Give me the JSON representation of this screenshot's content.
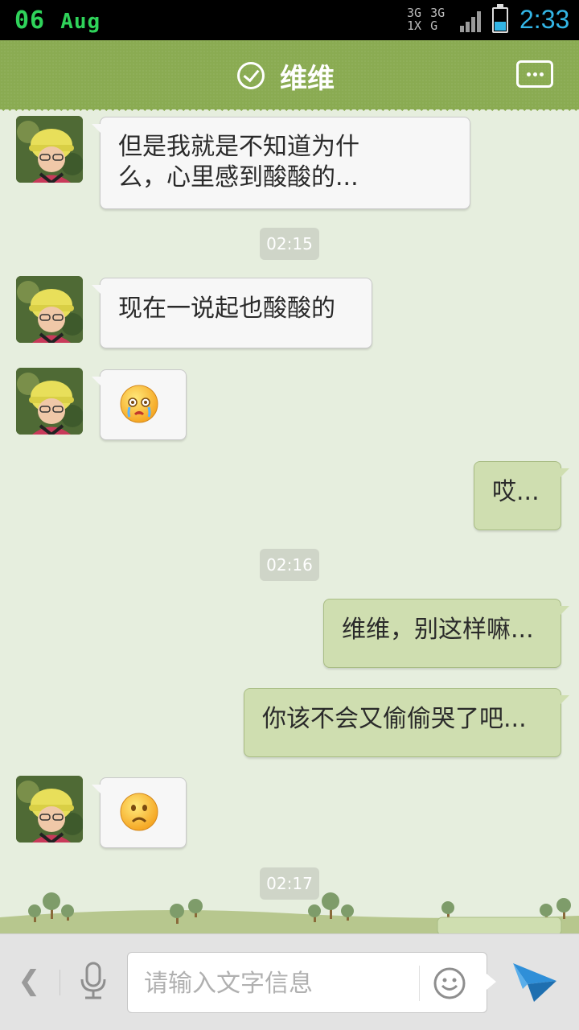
{
  "status_bar": {
    "date_day": "06",
    "date_month": "Aug",
    "network_top": "3G 3G 1X G",
    "time": "2:33"
  },
  "header": {
    "contact_name": "维维",
    "verified_icon": "check-circle-icon",
    "menu_icon": "chat-more-icon"
  },
  "messages": [
    {
      "type": "in",
      "text_line1": "但是我就是不知道为什",
      "text_line2": "么，心里感到酸酸的..."
    },
    {
      "type": "time",
      "text": "02:15"
    },
    {
      "type": "in",
      "text": "现在一说起也酸酸的"
    },
    {
      "type": "in",
      "emoji": "crying-face-emoji"
    },
    {
      "type": "out",
      "text": "哎..."
    },
    {
      "type": "time",
      "text": "02:16"
    },
    {
      "type": "out",
      "text": "维维，别这样嘛..."
    },
    {
      "type": "out",
      "text": "你该不会又偷偷哭了吧..."
    },
    {
      "type": "in",
      "emoji": "sad-face-emoji"
    },
    {
      "type": "time",
      "text": "02:17"
    }
  ],
  "input_bar": {
    "placeholder": "请输入文字信息",
    "back_icon": "chevron-left-icon",
    "mic_icon": "microphone-icon",
    "emoji_icon": "smiley-icon",
    "send_icon": "paper-plane-send-icon"
  },
  "colors": {
    "header": "#8aab52",
    "background": "#e6eede",
    "incoming_bubble": "#f7f7f7",
    "outgoing_bubble": "#cfdeb0",
    "status_time": "#33b5e5",
    "status_date": "#2fd35a"
  }
}
